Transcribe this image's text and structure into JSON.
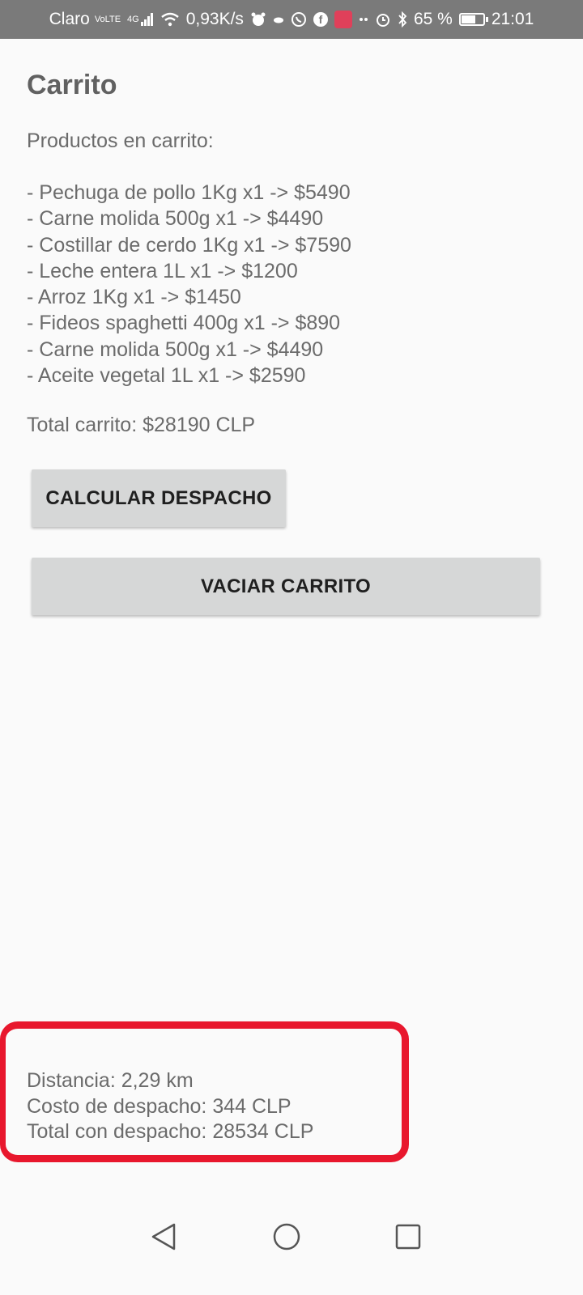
{
  "status_bar": {
    "carrier": "Claro",
    "network_top": "Vo",
    "network_bottom": "LTE",
    "signal_label": "4G",
    "speed": "0,93K/s",
    "battery_percent": "65 %",
    "battery_level": 0.65,
    "time": "21:01",
    "icons": [
      "volte-icon",
      "signal-icon",
      "wifi-icon",
      "alarm-app-icon",
      "cloud-icon",
      "whatsapp-icon",
      "facebook-icon",
      "shopping-app-icon",
      "more-dots-icon",
      "alarm-icon",
      "bluetooth-icon",
      "battery-icon"
    ]
  },
  "page": {
    "title": "Carrito",
    "products_heading": "Productos en carrito:",
    "items": [
      "- Pechuga de pollo 1Kg x1 -> $5490",
      "- Carne molida 500g x1 -> $4490",
      "- Costillar de cerdo 1Kg x1 -> $7590",
      "- Leche entera 1L x1 -> $1200",
      "- Arroz 1Kg x1 -> $1450",
      "- Fideos spaghetti 400g x1 -> $890",
      "- Carne molida 500g x1 -> $4490",
      "- Aceite vegetal 1L x1 -> $2590"
    ],
    "total": "Total carrito: $28190 CLP",
    "calc_button": "CALCULAR DESPACHO",
    "clear_button": "VACIAR CARRITO",
    "shipping": {
      "distance": "Distancia: 2,29 km",
      "cost": "Costo de despacho: 344 CLP",
      "grand_total": "Total con despacho: 28534 CLP"
    },
    "highlight_color": "#e8172d"
  },
  "nav_bar": {
    "icons": [
      "back-icon",
      "home-icon",
      "recents-icon"
    ]
  }
}
